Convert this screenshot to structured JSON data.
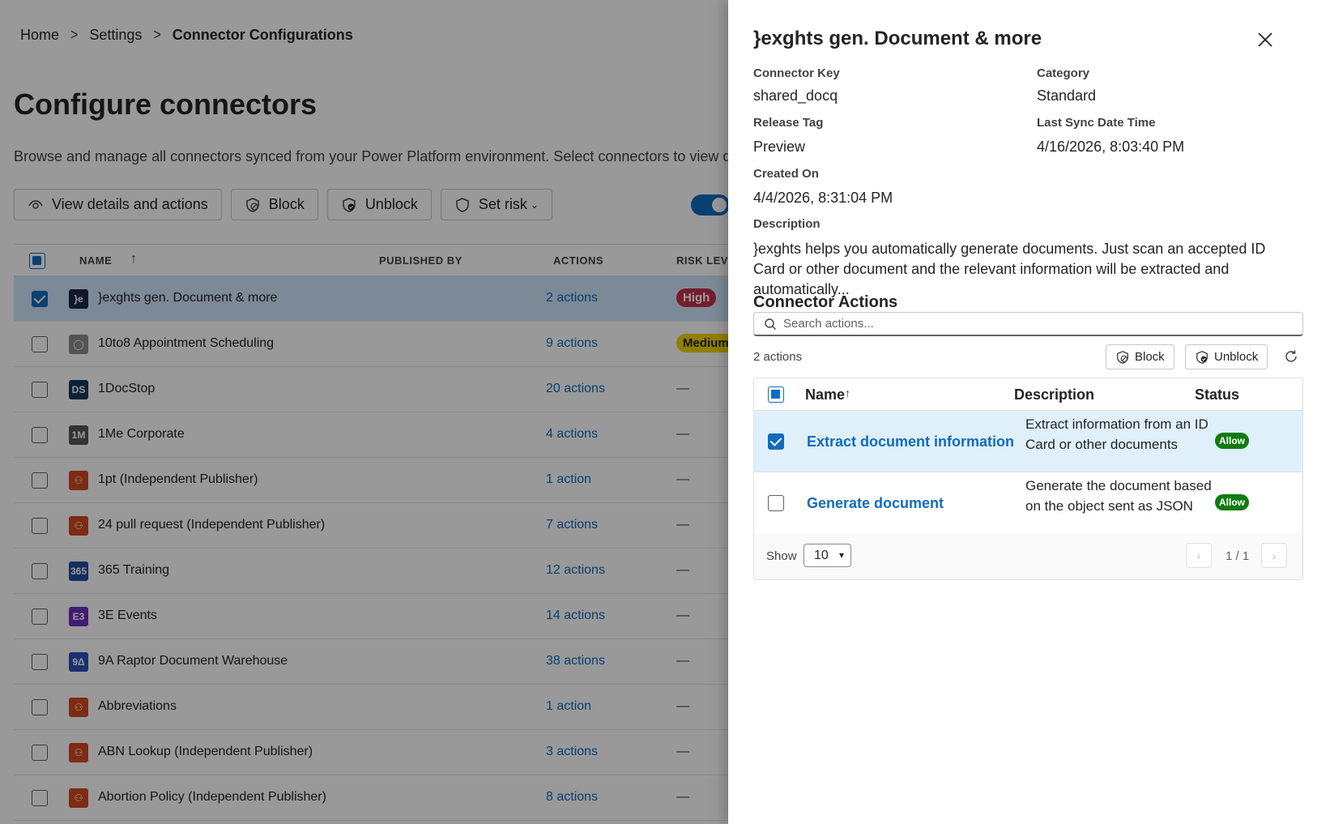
{
  "breadcrumb": {
    "home": "Home",
    "settings": "Settings",
    "current": "Connector Configurations"
  },
  "page": {
    "title": "Configure connectors",
    "description": "Browse and manage all connectors synced from your Power Platform environment. Select connectors to view detai"
  },
  "toolbar": {
    "view": "View details and actions",
    "block": "Block",
    "unblock": "Unblock",
    "set_risk": "Set risk"
  },
  "grid": {
    "headers": {
      "name": "NAME",
      "published_by": "PUBLISHED BY",
      "actions": "ACTIONS",
      "risk": "RISK LEV"
    },
    "rows": [
      {
        "name": "}exghts gen. Document & more",
        "actions": "2 actions",
        "risk": "High",
        "icon_color": "#1a2744",
        "icon_text": "}e"
      },
      {
        "name": "10to8 Appointment Scheduling",
        "actions": "9 actions",
        "risk": "Medium",
        "icon_color": "#8b8b8b",
        "icon_text": "◯"
      },
      {
        "name": "1DocStop",
        "actions": "20 actions",
        "risk": "—",
        "icon_color": "#14385c",
        "icon_text": "DS"
      },
      {
        "name": "1Me Corporate",
        "actions": "4 actions",
        "risk": "—",
        "icon_color": "#555555",
        "icon_text": "1M"
      },
      {
        "name": "1pt (Independent Publisher)",
        "actions": "1 action",
        "risk": "—",
        "icon_color": "#d04a20",
        "icon_text": "⚇"
      },
      {
        "name": "24 pull request (Independent Publisher)",
        "actions": "7 actions",
        "risk": "—",
        "icon_color": "#d04a20",
        "icon_text": "⚇"
      },
      {
        "name": "365 Training",
        "actions": "12 actions",
        "risk": "—",
        "icon_color": "#1f4e9c",
        "icon_text": "365"
      },
      {
        "name": "3E Events",
        "actions": "14 actions",
        "risk": "—",
        "icon_color": "#6b2fbf",
        "icon_text": "E3"
      },
      {
        "name": "9A Raptor Document Warehouse",
        "actions": "38 actions",
        "risk": "—",
        "icon_color": "#2851b8",
        "icon_text": "9Δ"
      },
      {
        "name": "Abbreviations",
        "actions": "1 action",
        "risk": "—",
        "icon_color": "#d04a20",
        "icon_text": "⚇"
      },
      {
        "name": "ABN Lookup (Independent Publisher)",
        "actions": "3 actions",
        "risk": "—",
        "icon_color": "#d04a20",
        "icon_text": "⚇"
      },
      {
        "name": "Abortion Policy (Independent Publisher)",
        "actions": "8 actions",
        "risk": "—",
        "icon_color": "#d04a20",
        "icon_text": "⚇"
      }
    ]
  },
  "drawer": {
    "title": "}exghts gen. Document & more",
    "fields": {
      "connector_key_label": "Connector Key",
      "connector_key": "shared_docq",
      "category_label": "Category",
      "category": "Standard",
      "release_tag_label": "Release Tag",
      "release_tag": "Preview",
      "last_sync_label": "Last Sync Date Time",
      "last_sync": "4/16/2026, 8:03:40 PM",
      "created_on_label": "Created On",
      "created_on": "4/4/2026, 8:31:04 PM",
      "description_label": "Description",
      "description": "}exghts helps you automatically generate documents. Just scan an accepted ID Card or other document and the relevant information will be extracted and automatically..."
    },
    "actions_section": "Connector Actions",
    "search_placeholder": "Search actions...",
    "count": "2 actions",
    "block": "Block",
    "unblock": "Unblock",
    "table": {
      "headers": {
        "name": "Name",
        "description": "Description",
        "status": "Status"
      },
      "rows": [
        {
          "name": "Extract document information",
          "description": "Extract information from an ID Card or other documents",
          "status": "Allow",
          "selected": true
        },
        {
          "name": "Generate document",
          "description": "Generate the document based on the object sent as JSON",
          "status": "Allow",
          "selected": false
        }
      ]
    },
    "footer": {
      "show_label": "Show",
      "page_size": "10",
      "pager": "1 / 1"
    }
  }
}
